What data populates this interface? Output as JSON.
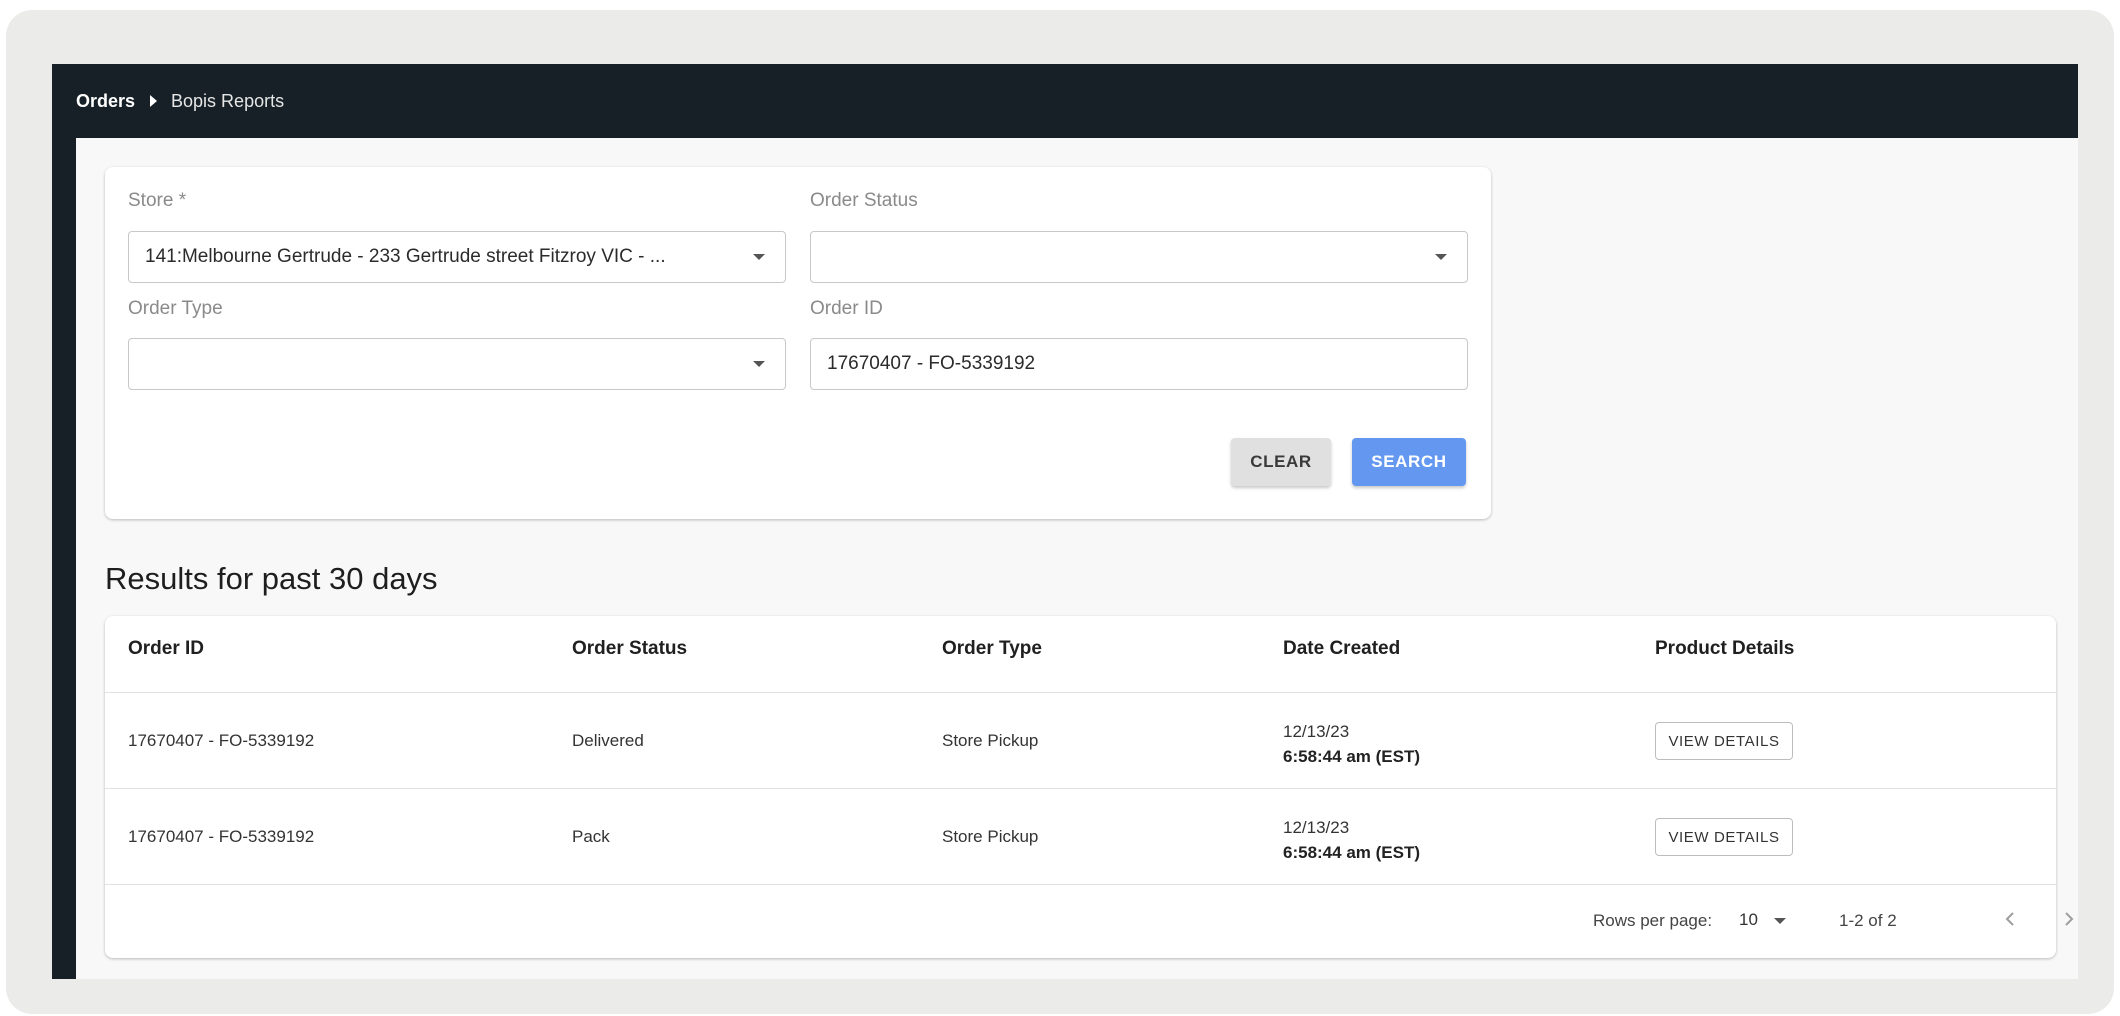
{
  "breadcrumb": {
    "root": "Orders",
    "current": "Bopis Reports"
  },
  "filters": {
    "store": {
      "label": "Store *",
      "value": "141:Melbourne Gertrude - 233 Gertrude street Fitzroy VIC - ..."
    },
    "order_status": {
      "label": "Order Status",
      "value": ""
    },
    "order_type": {
      "label": "Order Type",
      "value": ""
    },
    "order_id": {
      "label": "Order ID",
      "value": "17670407 - FO-5339192"
    },
    "clear_label": "CLEAR",
    "search_label": "SEARCH"
  },
  "results": {
    "title": "Results for past 30 days",
    "columns": [
      "Order ID",
      "Order Status",
      "Order Type",
      "Date Created",
      "Product Details"
    ],
    "rows": [
      {
        "order_id": "17670407 - FO-5339192",
        "status": "Delivered",
        "type": "Store Pickup",
        "date": "12/13/23",
        "time": "6:58:44 am (EST)",
        "action": "VIEW DETAILS"
      },
      {
        "order_id": "17670407 - FO-5339192",
        "status": "Pack",
        "type": "Store Pickup",
        "date": "12/13/23",
        "time": "6:58:44 am (EST)",
        "action": "VIEW DETAILS"
      }
    ]
  },
  "pagination": {
    "rows_per_page_label": "Rows per page:",
    "rows_per_page": "10",
    "range": "1-2 of 2"
  },
  "colors": {
    "topbar": "#172026",
    "search_button": "#6497f0",
    "clear_button": "#e0e0e0"
  },
  "icons": {
    "dropdown": "caret-down-icon",
    "prev": "chevron-left-icon",
    "next": "chevron-right-icon",
    "breadcrumb_sep": "caret-right-icon"
  }
}
